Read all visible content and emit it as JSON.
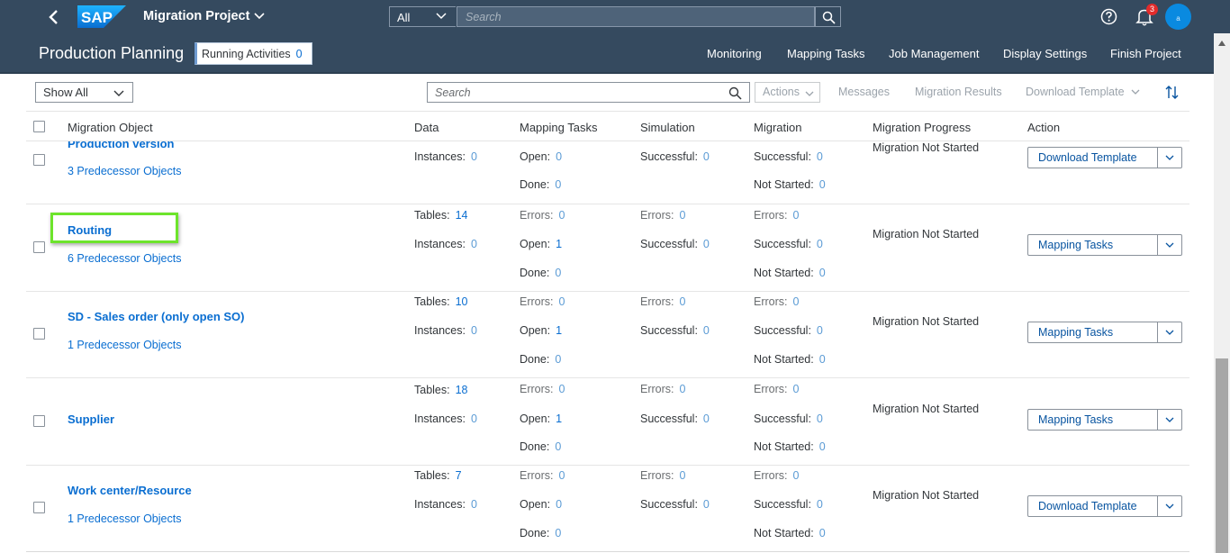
{
  "shell": {
    "logo": "SAP",
    "title": "Migration Project",
    "scope": "All",
    "search_placeholder": "Search",
    "notification_count": "3",
    "avatar_initial": "a"
  },
  "header": {
    "app_title": "Production Planning",
    "running_label": "Running Activities",
    "running_count": "0",
    "nav": [
      "Monitoring",
      "Mapping Tasks",
      "Job Management",
      "Display Settings",
      "Finish Project"
    ]
  },
  "toolbar": {
    "filter_value": "Show All",
    "search_placeholder": "Search",
    "actions_label": "Actions",
    "messages_label": "Messages",
    "results_label": "Migration Results",
    "download_label": "Download Template"
  },
  "table": {
    "headers": [
      "Migration Object",
      "Data",
      "Mapping Tasks",
      "Simulation",
      "Migration",
      "Migration Progress",
      "Action"
    ],
    "rows": [
      {
        "title": "Production version",
        "link": "3 Predecessor Objects",
        "tables": "",
        "instances": "0",
        "map_errors": "",
        "map_open": "0",
        "map_done": "0",
        "sim_errors": "",
        "sim_success": "0",
        "mig_errors": "",
        "mig_success": "0",
        "mig_notstarted": "0",
        "progress": "Migration Not Started",
        "action": "Download Template"
      },
      {
        "title": "Routing",
        "link": "6 Predecessor Objects",
        "tables": "14",
        "instances": "0",
        "map_errors": "0",
        "map_open": "1",
        "map_done": "0",
        "sim_errors": "0",
        "sim_success": "0",
        "mig_errors": "0",
        "mig_success": "0",
        "mig_notstarted": "0",
        "progress": "Migration Not Started",
        "action": "Mapping Tasks"
      },
      {
        "title": "SD - Sales order (only open SO)",
        "link": "1 Predecessor Objects",
        "tables": "10",
        "instances": "0",
        "map_errors": "0",
        "map_open": "1",
        "map_done": "0",
        "sim_errors": "0",
        "sim_success": "0",
        "mig_errors": "0",
        "mig_success": "0",
        "mig_notstarted": "0",
        "progress": "Migration Not Started",
        "action": "Mapping Tasks"
      },
      {
        "title": "Supplier",
        "link": "",
        "tables": "18",
        "instances": "0",
        "map_errors": "0",
        "map_open": "1",
        "map_done": "0",
        "sim_errors": "0",
        "sim_success": "0",
        "mig_errors": "0",
        "mig_success": "0",
        "mig_notstarted": "0",
        "progress": "Migration Not Started",
        "action": "Mapping Tasks"
      },
      {
        "title": "Work center/Resource",
        "link": "1 Predecessor Objects",
        "tables": "7",
        "instances": "0",
        "map_errors": "0",
        "map_open": "0",
        "map_done": "0",
        "sim_errors": "0",
        "sim_success": "0",
        "mig_errors": "0",
        "mig_success": "0",
        "mig_notstarted": "0",
        "progress": "Migration Not Started",
        "action": "Download Template"
      }
    ],
    "labels": {
      "tables": "Tables:",
      "instances": "Instances:",
      "errors": "Errors:",
      "open": "Open:",
      "done": "Done:",
      "successful": "Successful:",
      "not_started": "Not Started:"
    }
  },
  "colors": {
    "shell": "#354a5f",
    "link": "#0a6ed1",
    "highlight": "#6de42b"
  }
}
